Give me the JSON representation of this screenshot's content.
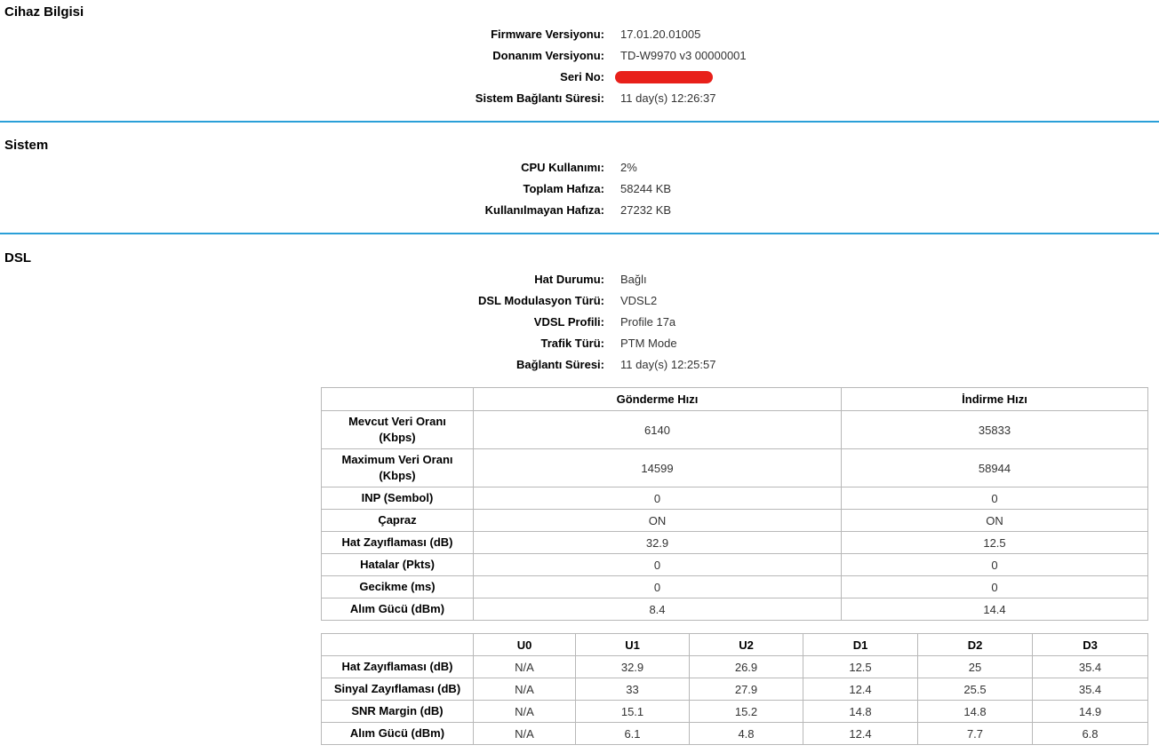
{
  "device": {
    "title": "Cihaz Bilgisi",
    "rows": [
      {
        "label": "Firmware Versiyonu:",
        "value": "17.01.20.01005"
      },
      {
        "label": "Donanım Versiyonu:",
        "value": "TD-W9970 v3 00000001"
      },
      {
        "label": "Seri No:",
        "value": ""
      },
      {
        "label": "Sistem Bağlantı Süresi:",
        "value": "11 day(s) 12:26:37"
      }
    ]
  },
  "system": {
    "title": "Sistem",
    "rows": [
      {
        "label": "CPU Kullanımı:",
        "value": "2%"
      },
      {
        "label": "Toplam Hafıza:",
        "value": "58244 KB"
      },
      {
        "label": "Kullanılmayan Hafıza:",
        "value": "27232 KB"
      }
    ]
  },
  "dsl": {
    "title": "DSL",
    "rows": [
      {
        "label": "Hat Durumu:",
        "value": "Bağlı"
      },
      {
        "label": "DSL Modulasyon Türü:",
        "value": "VDSL2"
      },
      {
        "label": "VDSL Profili:",
        "value": "Profile 17a"
      },
      {
        "label": "Trafik Türü:",
        "value": "PTM Mode"
      },
      {
        "label": "Bağlantı Süresi:",
        "value": "11 day(s) 12:25:57"
      }
    ],
    "rate_table": {
      "headers": [
        "",
        "Gönderme Hızı",
        "İndirme Hızı"
      ],
      "rows": [
        [
          "Mevcut Veri Oranı (Kbps)",
          "6140",
          "35833"
        ],
        [
          "Maximum Veri Oranı (Kbps)",
          "14599",
          "58944"
        ],
        [
          "INP (Sembol)",
          "0",
          "0"
        ],
        [
          "Çapraz",
          "ON",
          "ON"
        ],
        [
          "Hat Zayıflaması (dB)",
          "32.9",
          "12.5"
        ],
        [
          "Hatalar (Pkts)",
          "0",
          "0"
        ],
        [
          "Gecikme (ms)",
          "0",
          "0"
        ],
        [
          "Alım Gücü (dBm)",
          "8.4",
          "14.4"
        ]
      ]
    },
    "band_table": {
      "headers": [
        "",
        "U0",
        "U1",
        "U2",
        "D1",
        "D2",
        "D3"
      ],
      "rows": [
        [
          "Hat Zayıflaması (dB)",
          "N/A",
          "32.9",
          "26.9",
          "12.5",
          "25",
          "35.4"
        ],
        [
          "Sinyal Zayıflaması (dB)",
          "N/A",
          "33",
          "27.9",
          "12.4",
          "25.5",
          "35.4"
        ],
        [
          "SNR Margin (dB)",
          "N/A",
          "15.1",
          "15.2",
          "14.8",
          "14.8",
          "14.9"
        ],
        [
          "Alım Gücü (dBm)",
          "N/A",
          "6.1",
          "4.8",
          "12.4",
          "7.7",
          "6.8"
        ]
      ]
    }
  }
}
